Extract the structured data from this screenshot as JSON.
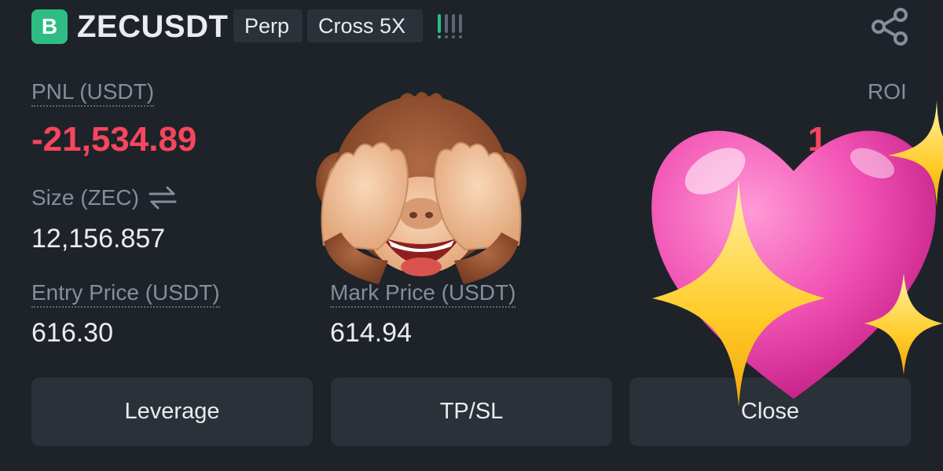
{
  "header": {
    "badge_letter": "B",
    "symbol": "ZECUSDT",
    "tags": [
      "Perp",
      "Cross 5X"
    ],
    "icons": [
      "signal-bars-icon",
      "share-icon"
    ]
  },
  "position": {
    "pnl_label": "PNL (USDT)",
    "pnl_value": "-21,534.89",
    "roi_label": "ROI",
    "roi_value_visible": "1",
    "size_label": "Size (ZEC)",
    "size_value": "12,156.857",
    "entry_label": "Entry Price (USDT)",
    "entry_value": "616.30",
    "mark_label": "Mark Price (USDT)",
    "mark_value": "614.94"
  },
  "actions": {
    "leverage_label": "Leverage",
    "tpsl_label": "TP/SL",
    "close_label": "Close"
  },
  "stickers": [
    "see-no-evil-monkey-emoji",
    "sparkling-heart-emoji"
  ],
  "colors": {
    "background": "#1e2329",
    "panel": "#2b3139",
    "negative": "#f6465d",
    "positive": "#2ebd85",
    "muted_text": "#848e9c",
    "primary_text": "#eaecef"
  }
}
